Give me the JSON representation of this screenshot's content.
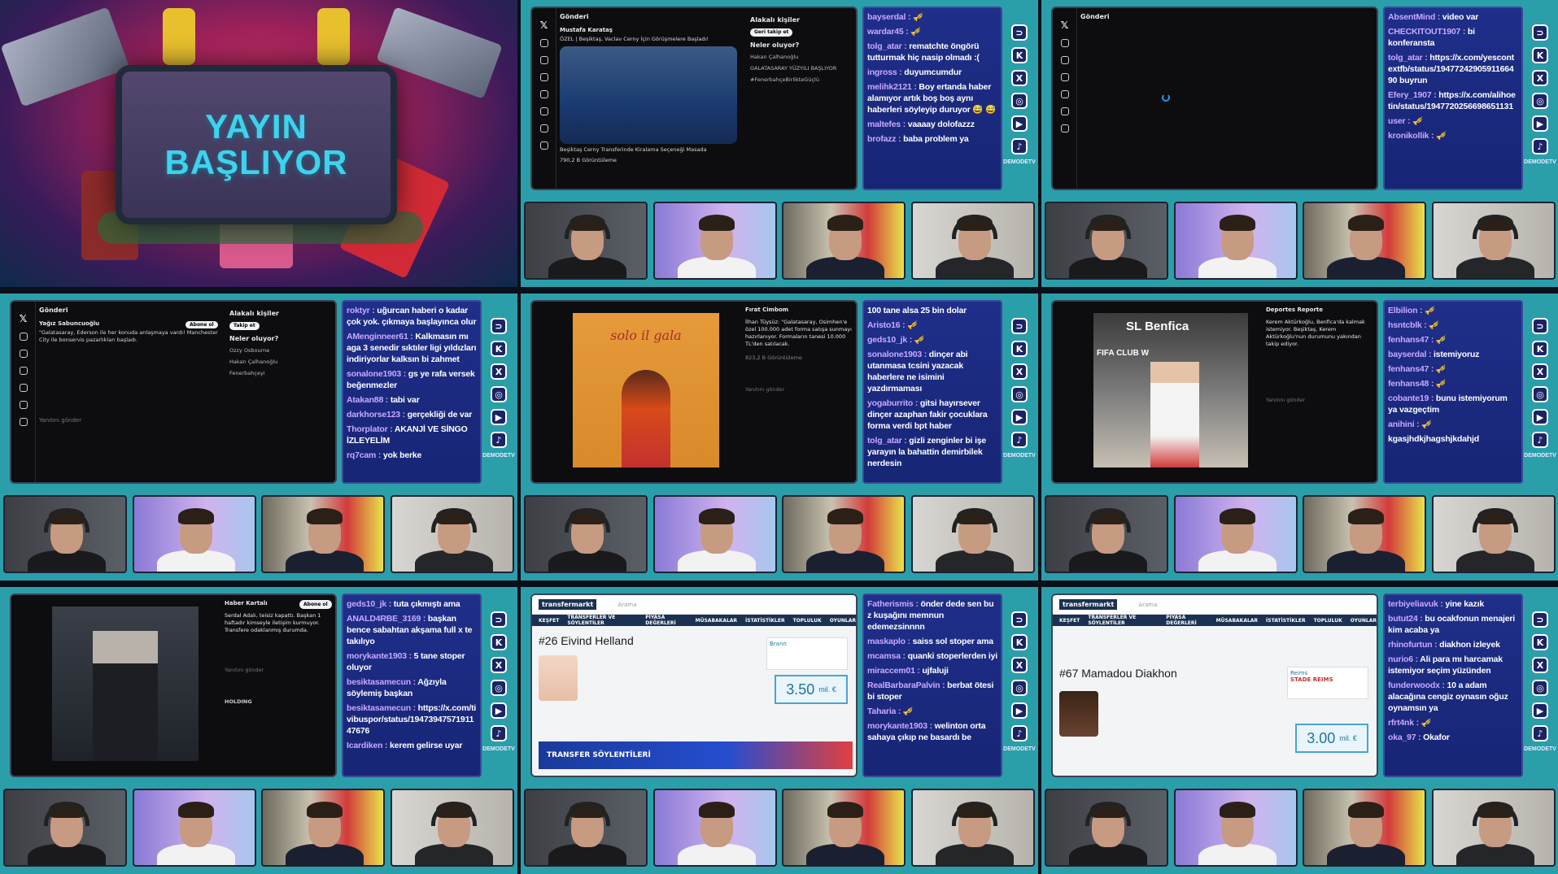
{
  "intro": {
    "line1": "YAYIN",
    "line2": "BAŞLIYOR"
  },
  "social_brand": "DEMODETV",
  "cell2": {
    "header": "Gönderi",
    "author": "Mustafa Karataş",
    "text": "ÖZEL | Beşiktaş, Vaclav Cerny İçin Görüşmelere Başladı!",
    "caption": "Beşiktaş Cerny Transferinde Kiralama Seçeneği Masada",
    "stats": "790,2 B Görüntüleme",
    "right_title": "Alakalı kişiler",
    "right_title2": "Neler oluyor?",
    "trend1": "Hakan Çalhanoğlu",
    "trend2": "GALATASARAY YÜZYILI BAŞLIYOR",
    "trend3": "#FenerbahçeBirlikteGüçlü",
    "follow": "Geri takip et",
    "chat": [
      {
        "u": "bayserdal :",
        "m": " 🎺"
      },
      {
        "u": "wardar45 :",
        "m": " 🎺"
      },
      {
        "u": "tolg_atar :",
        "m": " rematchte öngörü tutturmak hiç nasip olmadı :("
      },
      {
        "u": "ingross :",
        "m": " duyumcumdur"
      },
      {
        "u": "melihk2121 :",
        "m": " Boy ertanda haber alamıyor artık boş boş aynı haberleri söyleyip duruyor 😅 😅"
      },
      {
        "u": "maltefes :",
        "m": " vaaaay dolofazzz"
      },
      {
        "u": "brofazz :",
        "m": " baba problem ya"
      }
    ]
  },
  "cell3": {
    "header": "Gönderi",
    "chat": [
      {
        "u": "AbsentMind :",
        "m": " video var"
      },
      {
        "u": "CHECKITOUT1907 :",
        "m": " bi konferansta"
      },
      {
        "u": "tolg_atar :",
        "m": " https://x.com/yescontextfb/status/1947724290591166490 buyrun"
      },
      {
        "u": "Efery_1907 :",
        "m": " https://x.com/alihoetin/status/1947720256698651131"
      },
      {
        "u": "user :",
        "m": " 🎺"
      },
      {
        "u": "kronikollik :",
        "m": " 🎺"
      }
    ]
  },
  "cell4": {
    "header": "Gönderi",
    "author": "Yağız Sabuncuoğlu",
    "text": "\"Galatasaray, Ederson ile her konuda anlaşmaya vardı! Manchester City ile bonservis pazarlıkları başladı.",
    "right_title": "Alakalı kişiler",
    "right_title2": "Neler oluyor?",
    "follow": "Takip et",
    "trend1": "Ozzy Osbourne",
    "trend2": "Hakan Çalhanoğlu",
    "trend3": "Fenerbahçeyi",
    "subscribe": "Abone ol",
    "reply": "Yanıtını gönder",
    "chat": [
      {
        "u": "roktyr :",
        "m": " uğurcan haberi o kadar çok yok. çıkmaya başlayınca olur"
      },
      {
        "u": "AMenginneer61 :",
        "m": " Kalkmasın mı aga 3 senedir sıktıler ligi yıldızları indiriyorlar kalksın bi zahmet"
      },
      {
        "u": "sonalone1903 :",
        "m": " gs ye rafa versek beğenmezler"
      },
      {
        "u": "Atakan88 :",
        "m": " tabi var"
      },
      {
        "u": "darkhorse123 :",
        "m": " gerçekliği de var"
      },
      {
        "u": "Thorplator :",
        "m": " AKANJİ VE SİNGO İZLEYELİM"
      },
      {
        "u": "rq7cam :",
        "m": " yok berke"
      }
    ]
  },
  "cell5": {
    "media_text": "solo il gala",
    "author": "Fırat Cimbom",
    "text": "İlhan Tüysüz: \"Galatasaray, Osimhen'e özel 100.000 adet forma satışa sunmayı hazırlanıyor. Formaların tanesi 10.000 TL'den satılacak.",
    "stats": "823,2 B Görüntüleme",
    "reply": "Yanıtını gönder",
    "chat": [
      {
        "u": "",
        "m": "100 tane alsa 25 bin dolar"
      },
      {
        "u": "Aristo16 :",
        "m": " 🎺"
      },
      {
        "u": "geds10_jk :",
        "m": " 🎺"
      },
      {
        "u": "sonalone1903 :",
        "m": " dinçer abi utanmasa tcsini yazacak haberlere ne isimini yazdırmaması"
      },
      {
        "u": "yogaburrito :",
        "m": " gitsi hayırsever dinçer azaphan fakir çocuklara forma verdi bpt haber"
      },
      {
        "u": "tolg_atar :",
        "m": " gizli zenginler bi işe yarayın la bahattin demirbilek nerdesin"
      }
    ]
  },
  "cell6": {
    "media_text": "SL Benfica",
    "media_text2": "FIFA CLUB W",
    "author": "Deportes Reporte",
    "text": "Kerem Aktürkoğlu, Benfica'da kalmak istemiyor. Beşiktaş, Kerem Aktürkoğlu'nun durumunu yakından takip ediyor.",
    "reply": "Yanıtını gönder",
    "chat": [
      {
        "u": "Elbilion :",
        "m": " 🎺"
      },
      {
        "u": "hsntcblk :",
        "m": " 🎺"
      },
      {
        "u": "fenhans47 :",
        "m": " 🎺"
      },
      {
        "u": "bayserdal :",
        "m": " istemiyoruz"
      },
      {
        "u": "fenhans47 :",
        "m": " 🎺"
      },
      {
        "u": "fenhans48 :",
        "m": " 🎺"
      },
      {
        "u": "cobante19 :",
        "m": " bunu istemiyorum ya vazgeçtim"
      },
      {
        "u": "anihini :",
        "m": " 🎺"
      },
      {
        "u": "",
        "m": "kgasjhdkjhagshjkdahjd"
      }
    ]
  },
  "cell7": {
    "author": "Haber Kartalı",
    "text": "Serdal Adalı, teisiz kapattı. Başkan 1 haftadır kimseyle iletişim kurmuyor. Transfere odaklanmış durumda.",
    "subscribe": "Abone ol",
    "reply": "Yanıtını gönder",
    "holding": "HOLDING",
    "chat": [
      {
        "u": "geds10_jk :",
        "m": " tuta çıkmıştı ama"
      },
      {
        "u": "ANALD4RBE_3169 :",
        "m": " başkan bence sabahtan akşama full x te takılıyo"
      },
      {
        "u": "morykante1903 :",
        "m": " 5 tane stoper oluyor"
      },
      {
        "u": "besiktasamecun :",
        "m": " Ağzıyla söylemiş başkan"
      },
      {
        "u": "besiktasamecun :",
        "m": " https://x.com/tivibuspor/status/1947394757191147676"
      },
      {
        "u": "Icardiken :",
        "m": " kerem gelirse uyar"
      }
    ]
  },
  "cell8": {
    "logo": "transfermarkt",
    "nav": [
      "KEŞFET",
      "TRANSFERLER VE SÖYLENTİLER",
      "PİYASA DEĞERLERİ",
      "MÜSABAKALAR",
      "İSTATİSTİKLER",
      "TOPLULUK",
      "OYUNLAR"
    ],
    "player": "#26 Eivind Helland",
    "club": "Brann",
    "value": "3.50",
    "value_unit": "mil. €",
    "banner": "TRANSFER SÖYLENTİLERİ",
    "search": "Arama",
    "chat": [
      {
        "u": "Fatherismis :",
        "m": " önder dede sen bu z kuşağını memnun edemezsinnnn"
      },
      {
        "u": "maskaplo :",
        "m": " saiss sol stoper ama"
      },
      {
        "u": "mcamsa :",
        "m": " quanki stoperlerden iyi"
      },
      {
        "u": "miraccem01 :",
        "m": " ujfaluji"
      },
      {
        "u": "RealBarbaraPalvin :",
        "m": " berbat ötesi bi stoper"
      },
      {
        "u": "Taharia :",
        "m": " 🎺"
      },
      {
        "u": "morykante1903 :",
        "m": " welinton orta sahaya çıkıp ne basardı be"
      }
    ]
  },
  "cell9": {
    "logo": "transfermarkt",
    "nav": [
      "KEŞFET",
      "TRANSFERLER VE SÖYLENTİLER",
      "PİYASA DEĞERLERİ",
      "MÜSABAKALAR",
      "İSTATİSTİKLER",
      "TOPLULUK",
      "OYUNLAR"
    ],
    "player": "#67 Mamadou Diakhon",
    "club": "Reims",
    "club_badge": "STADE REIMS",
    "value": "3.00",
    "value_unit": "mil. €",
    "search": "Arama",
    "chat": [
      {
        "u": "terbiyeliavuk :",
        "m": " yine kazık"
      },
      {
        "u": "butut24 :",
        "m": " bu ocakfonun menajeri kim acaba ya"
      },
      {
        "u": "rhinofurtun :",
        "m": " diakhon izleyek"
      },
      {
        "u": "nurio6 :",
        "m": " Ali para mı harcamak istemiyor seçim yüzünden"
      },
      {
        "u": "funderwoodx :",
        "m": " 10 a adam alacağına cengiz oynasın oğuz oynamsın ya"
      },
      {
        "u": "rfrt4nk :",
        "m": " 🎺"
      },
      {
        "u": "oka_97 :",
        "m": " Okafor"
      }
    ]
  }
}
